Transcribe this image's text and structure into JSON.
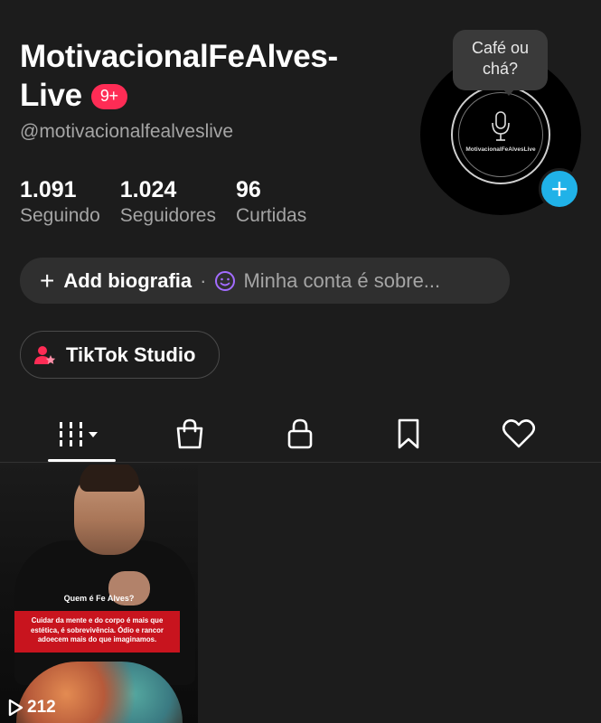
{
  "profile": {
    "name_line1": "MotivacionalFeAlves-",
    "name_line2": "Live",
    "notification_badge": "9+",
    "username": "@motivacionalfealveslive"
  },
  "stats": [
    {
      "value": "1.091",
      "label": "Seguindo"
    },
    {
      "value": "1.024",
      "label": "Seguidores"
    },
    {
      "value": "96",
      "label": "Curtidas"
    }
  ],
  "avatar": {
    "caption": "MotivacionalFeAlvesLive",
    "bubble_text": "Café ou chá?",
    "add_icon": "plus-icon"
  },
  "bio": {
    "add_label": "Add biografia",
    "separator": "·",
    "hint": "Minha conta é sobre..."
  },
  "studio": {
    "label": "TikTok Studio"
  },
  "tabs": [
    {
      "icon": "videos-grid-icon",
      "active": true
    },
    {
      "icon": "shopping-bag-icon",
      "active": false
    },
    {
      "icon": "lock-icon",
      "active": false
    },
    {
      "icon": "bookmark-icon",
      "active": false
    },
    {
      "icon": "heart-icon",
      "active": false
    }
  ],
  "videos": [
    {
      "title": "Quem é Fe Alves?",
      "caption": "Cuidar da mente e do corpo é mais que estética, é sobrevivência. Ódio e rancor adoecem mais do que imaginamos.",
      "views": "212"
    }
  ],
  "colors": {
    "background": "#1c1c1c",
    "badge": "#fe2c55",
    "add_button": "#20b2e8",
    "secondary_text": "#a5a5a5",
    "bio_smile": "#a36cff"
  }
}
